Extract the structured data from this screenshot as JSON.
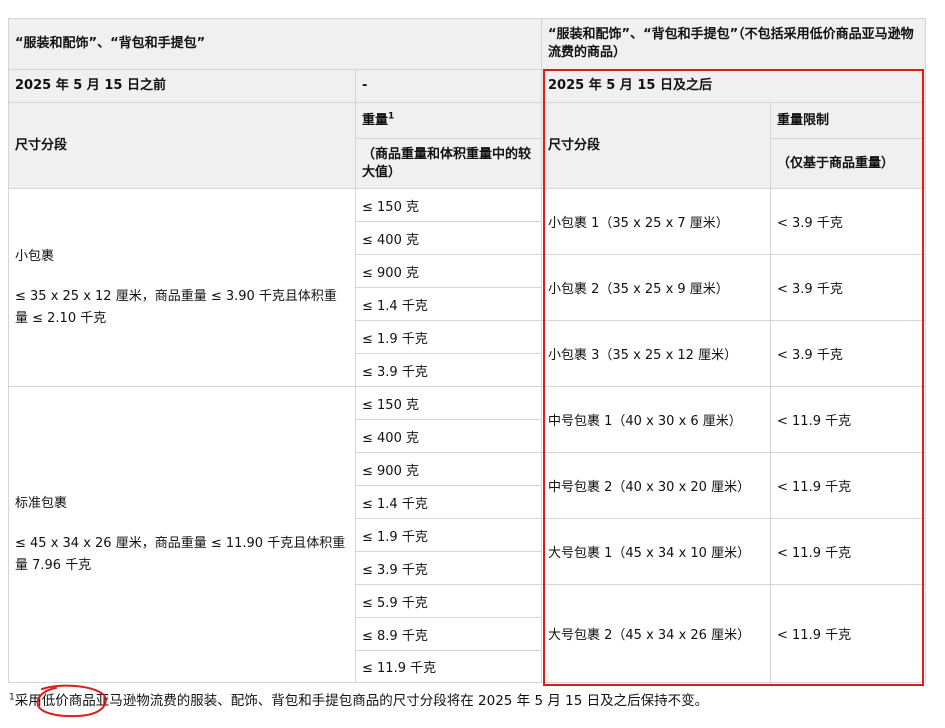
{
  "header": {
    "left_title": "“服装和配饰”、“背包和手提包”",
    "right_title": "“服装和配饰”、“背包和手提包”（不包括采用低价商品亚马逊物流费的商品）"
  },
  "band": {
    "before": "2025 年 5 月 15 日之前",
    "dash": "-",
    "after": "2025 年 5 月 15 日及之后"
  },
  "subheader": {
    "size_tier": "尺寸分段",
    "weight": "重量",
    "weight_sup": "1",
    "weight_note": "（商品重量和体积重量中的较大值）",
    "size_tier_right": "尺寸分段",
    "weight_limit": "重量限制",
    "weight_limit_note": "（仅基于商品重量）"
  },
  "left_groups": [
    {
      "name": "小包裹",
      "criteria": "≤ 35 x 25 x 12 厘米，商品重量 ≤ 3.90 千克且体积重量 ≤ 2.10 千克",
      "weights": [
        "≤ 150 克",
        "≤ 400 克",
        "≤ 900 克",
        "≤ 1.4 千克",
        "≤ 1.9 千克",
        "≤ 3.9 千克"
      ]
    },
    {
      "name": "标准包裹",
      "criteria": "≤ 45 x 34 x 26 厘米，商品重量 ≤ 11.90 千克且体积重量 7.96 千克",
      "weights": [
        "≤ 150 克",
        "≤ 400 克",
        "≤ 900 克",
        "≤ 1.4 千克",
        "≤ 1.9 千克",
        "≤ 3.9 千克",
        "≤ 5.9 千克",
        "≤ 8.9 千克",
        "≤ 11.9 千克"
      ]
    }
  ],
  "right_rows": [
    {
      "tier": "小包裹 1（35 x 25 x 7 厘米）",
      "limit": "< 3.9 千克"
    },
    {
      "tier": "小包裹 2（35 x 25 x 9 厘米）",
      "limit": "< 3.9 千克"
    },
    {
      "tier": "小包裹 3（35 x 25 x 12 厘米）",
      "limit": "< 3.9 千克"
    },
    {
      "tier": "中号包裹 1（40 x 30 x 6 厘米）",
      "limit": "< 11.9 千克"
    },
    {
      "tier": "中号包裹 2（40 x 30 x 20 厘米）",
      "limit": "< 11.9 千克"
    },
    {
      "tier": "大号包裹 1（45 x 34 x 10 厘米）",
      "limit": "< 11.9 千克"
    },
    {
      "tier": "大号包裹 2（45 x 34 x 26 厘米）",
      "limit": "< 11.9 千克"
    }
  ],
  "footnote": {
    "marker": "1",
    "text": "采用低价商品亚马逊物流费的服装、配饰、背包和手提包商品的尺寸分段将在 2025 年 5 月 15 日及之后保持不变。"
  },
  "annotation_colors": {
    "highlight_box": "#e01b1b",
    "hand_circle": "#e01b1b"
  }
}
